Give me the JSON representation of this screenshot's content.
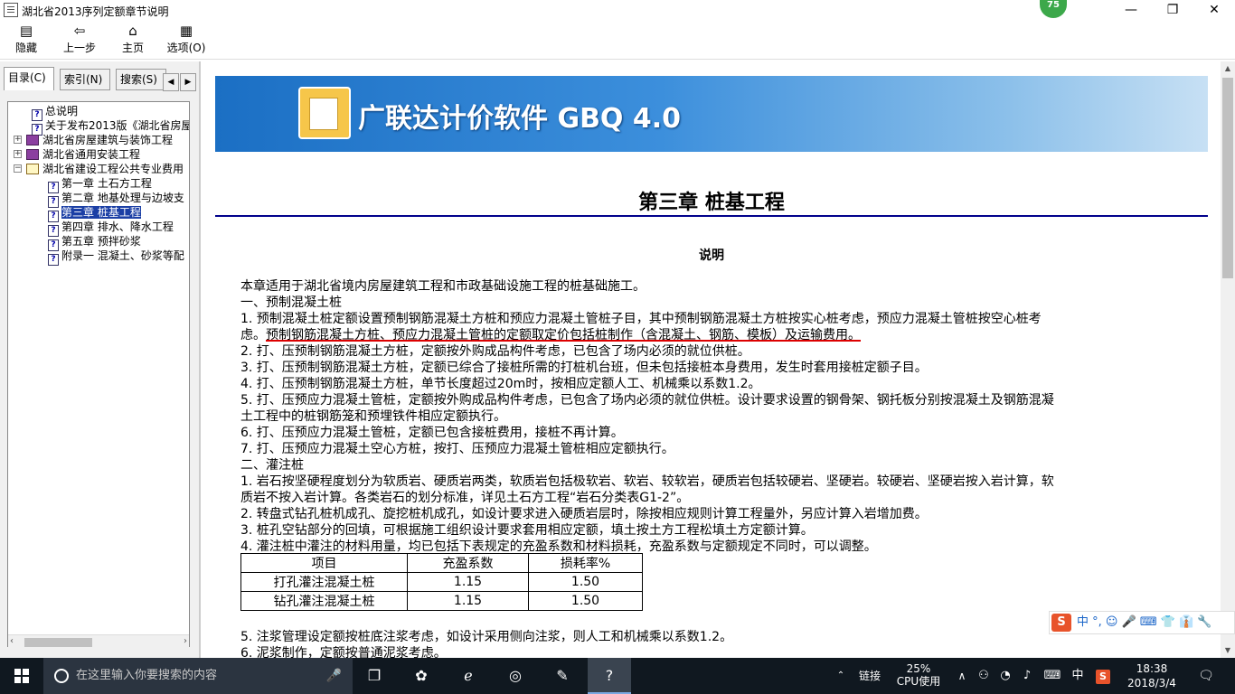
{
  "window": {
    "title": "湖北省2013序列定额章节说明",
    "badge": "75"
  },
  "toolbar": {
    "hide": "隐藏",
    "back": "上一步",
    "home": "主页",
    "options": "选项(O)"
  },
  "tabs": {
    "contents": "目录(C)",
    "index": "索引(N)",
    "search": "搜索(S)"
  },
  "tree": [
    {
      "label": "总说明"
    },
    {
      "label": "关于发布2013版《湖北省房屋"
    },
    {
      "label": "湖北省房屋建筑与装饰工程"
    },
    {
      "label": "湖北省通用安装工程"
    },
    {
      "label": "湖北省建设工程公共专业费用"
    },
    {
      "label": "第一章 土石方工程"
    },
    {
      "label": "第二章 地基处理与边坡支"
    },
    {
      "label": "第三章 桩基工程"
    },
    {
      "label": "第四章 排水、降水工程"
    },
    {
      "label": "第五章 预拌砂浆"
    },
    {
      "label": "附录一 混凝土、砂浆等配"
    }
  ],
  "banner": {
    "text": "广联达计价软件 GBQ 4.0"
  },
  "doc": {
    "chapter": "第三章  桩基工程",
    "subtitle": "说明",
    "lines": [
      "本章适用于湖北省境内房屋建筑工程和市政基础设施工程的桩基础施工。",
      "一、预制混凝土桩",
      "1. 预制混凝土桩定额设置预制钢筋混凝土方桩和预应力混凝土管桩子目，其中预制钢筋混凝土方桩按实心桩考虑，预应力混凝土管桩按空心桩考",
      "虑。",
      "预制钢筋混凝土方桩、预应力混凝土管桩的定额取定价包括桩制作（含混凝土、钢筋、模板）及运输费用。",
      "2. 打、压预制钢筋混凝土方桩，定额按外购成品构件考虑，已包含了场内必须的就位供桩。",
      "3. 打、压预制钢筋混凝土方桩，定额已综合了接桩所需的打桩机台班，但未包括接桩本身费用，发生时套用接桩定额子目。",
      "4. 打、压预制钢筋混凝土方桩，单节长度超过20m时，按相应定额人工、机械乘以系数1.2。",
      "5. 打、压预应力混凝土管桩，定额按外购成品构件考虑，已包含了场内必须的就位供桩。设计要求设置的钢骨架、钢托板分别按混凝土及钢筋混凝",
      "土工程中的桩钢筋笼和预埋铁件相应定额执行。",
      "6. 打、压预应力混凝土管桩，定额已包含接桩费用，接桩不再计算。",
      "7. 打、压预应力混凝土空心方桩，按打、压预应力混凝土管桩相应定额执行。",
      "二、灌注桩",
      "1. 岩石按坚硬程度划分为软质岩、硬质岩两类，软质岩包括极软岩、软岩、较软岩，硬质岩包括较硬岩、坚硬岩。较硬岩、坚硬岩按入岩计算，软",
      "质岩不按入岩计算。各类岩石的划分标准，详见土石方工程“岩石分类表G1-2”。",
      "2. 转盘式钻孔桩机成孔、旋挖桩机成孔，如设计要求进入硬质岩层时，除按相应规则计算工程量外，另应计算入岩增加费。",
      "3. 桩孔空钻部分的回填，可根据施工组织设计要求套用相应定额，填土按土方工程松填土方定额计算。",
      "4. 灌注桩中灌注的材料用量，均已包括下表规定的充盈系数和材料损耗，充盈系数与定额规定不同时，可以调整。"
    ],
    "table": {
      "headers": [
        "项目",
        "充盈系数",
        "损耗率%"
      ],
      "rows": [
        [
          "打孔灌注混凝土桩",
          "1.15",
          "1.50"
        ],
        [
          "钻孔灌注混凝土桩",
          "1.15",
          "1.50"
        ]
      ]
    },
    "after": [
      "5. 注浆管理设定额按桩底注浆考虑，如设计采用侧向注浆，则人工和机械乘以系数1.2。",
      "6. 泥浆制作，定额按普通泥浆考虑。"
    ]
  },
  "ime": {
    "items": "中 °, ☺ 🎤 ⌨ 👕 👔 🔧"
  },
  "taskbar": {
    "search_placeholder": "在这里输入你要搜索的内容",
    "link": "链接",
    "cpu_percent": "25%",
    "cpu_label": "CPU使用",
    "ime_lang": "中",
    "time": "18:38",
    "date": "2018/3/4"
  }
}
